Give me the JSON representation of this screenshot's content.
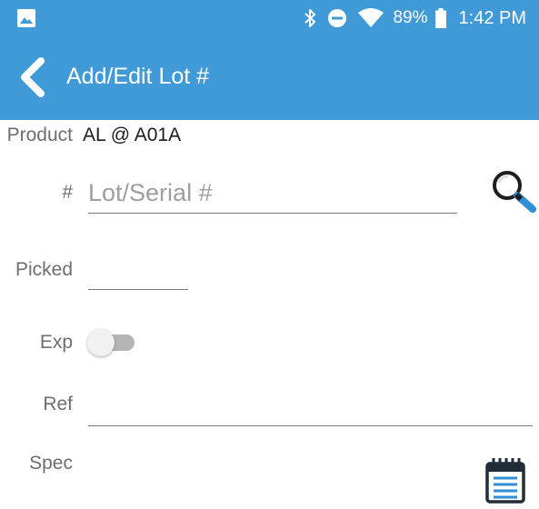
{
  "status_bar": {
    "gallery_icon": "image-icon",
    "bluetooth_icon": "bluetooth-icon",
    "dnd_icon": "do-not-disturb-icon",
    "wifi_icon": "wifi-icon",
    "battery_percent": "89%",
    "battery_icon": "battery-icon",
    "time": "1:42 PM"
  },
  "app_bar": {
    "back_icon": "chevron-left-icon",
    "title": "Add/Edit Lot #",
    "color": "#3f9ad7"
  },
  "form": {
    "product_label": "Product",
    "product_value": "AL @ A01A",
    "lot_label": "#",
    "lot_value": "",
    "lot_placeholder": "Lot/Serial #",
    "search_icon": "search-icon",
    "picked_label": "Picked",
    "picked_value": "",
    "exp_label": "Exp",
    "exp_toggle_on": false,
    "ref_label": "Ref",
    "ref_value": "",
    "spec_label": "Spec",
    "spec_icon": "notepad-icon"
  }
}
